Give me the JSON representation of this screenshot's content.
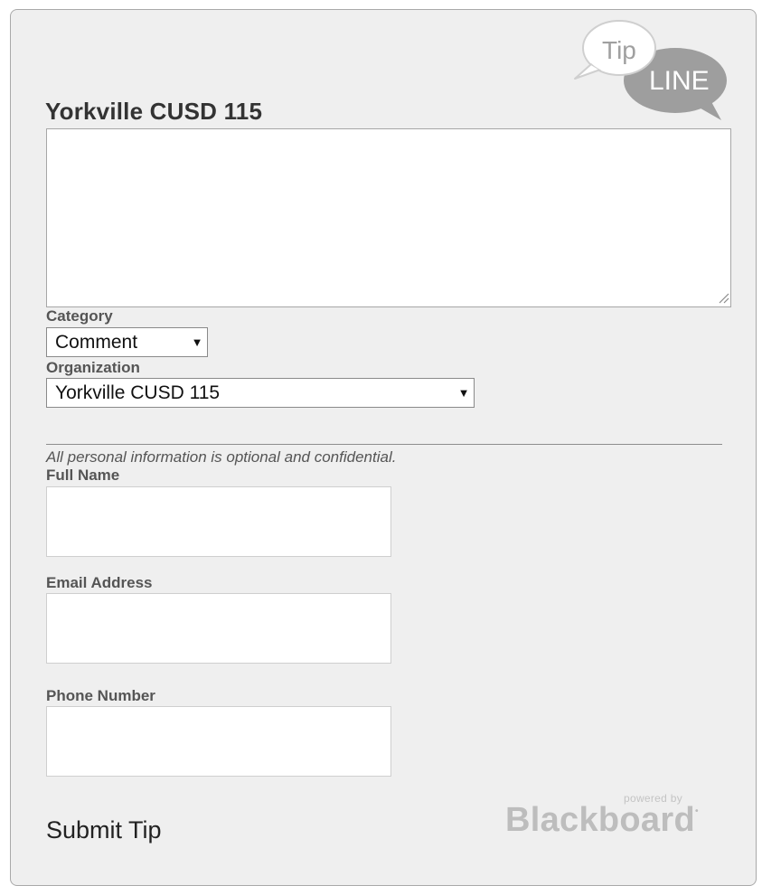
{
  "logo": {
    "top_text": "Tip",
    "bottom_text": "LINE",
    "bubble_light": "#ffffff",
    "bubble_dark": "#9e9e9e",
    "icon": "tipline-speech-bubbles-logo"
  },
  "form": {
    "organization_title": "Yorkville CUSD 115",
    "tip_text_value": "",
    "category": {
      "label": "Category",
      "selected": "Comment"
    },
    "organization": {
      "label": "Organization",
      "selected": "Yorkville CUSD 115"
    },
    "privacy_note": "All personal information is optional and confidential.",
    "full_name": {
      "label": "Full Name",
      "value": ""
    },
    "email": {
      "label": "Email Address",
      "value": ""
    },
    "phone": {
      "label": "Phone Number",
      "value": ""
    },
    "submit_label": "Submit Tip"
  },
  "footer": {
    "powered_by": "powered by",
    "brand": "Blackboard"
  },
  "colors": {
    "panel_bg": "#efefef",
    "panel_border": "#a9a9a9",
    "title_text": "#333333",
    "label_text": "#555555",
    "brand_gray": "#bdbdbd"
  }
}
